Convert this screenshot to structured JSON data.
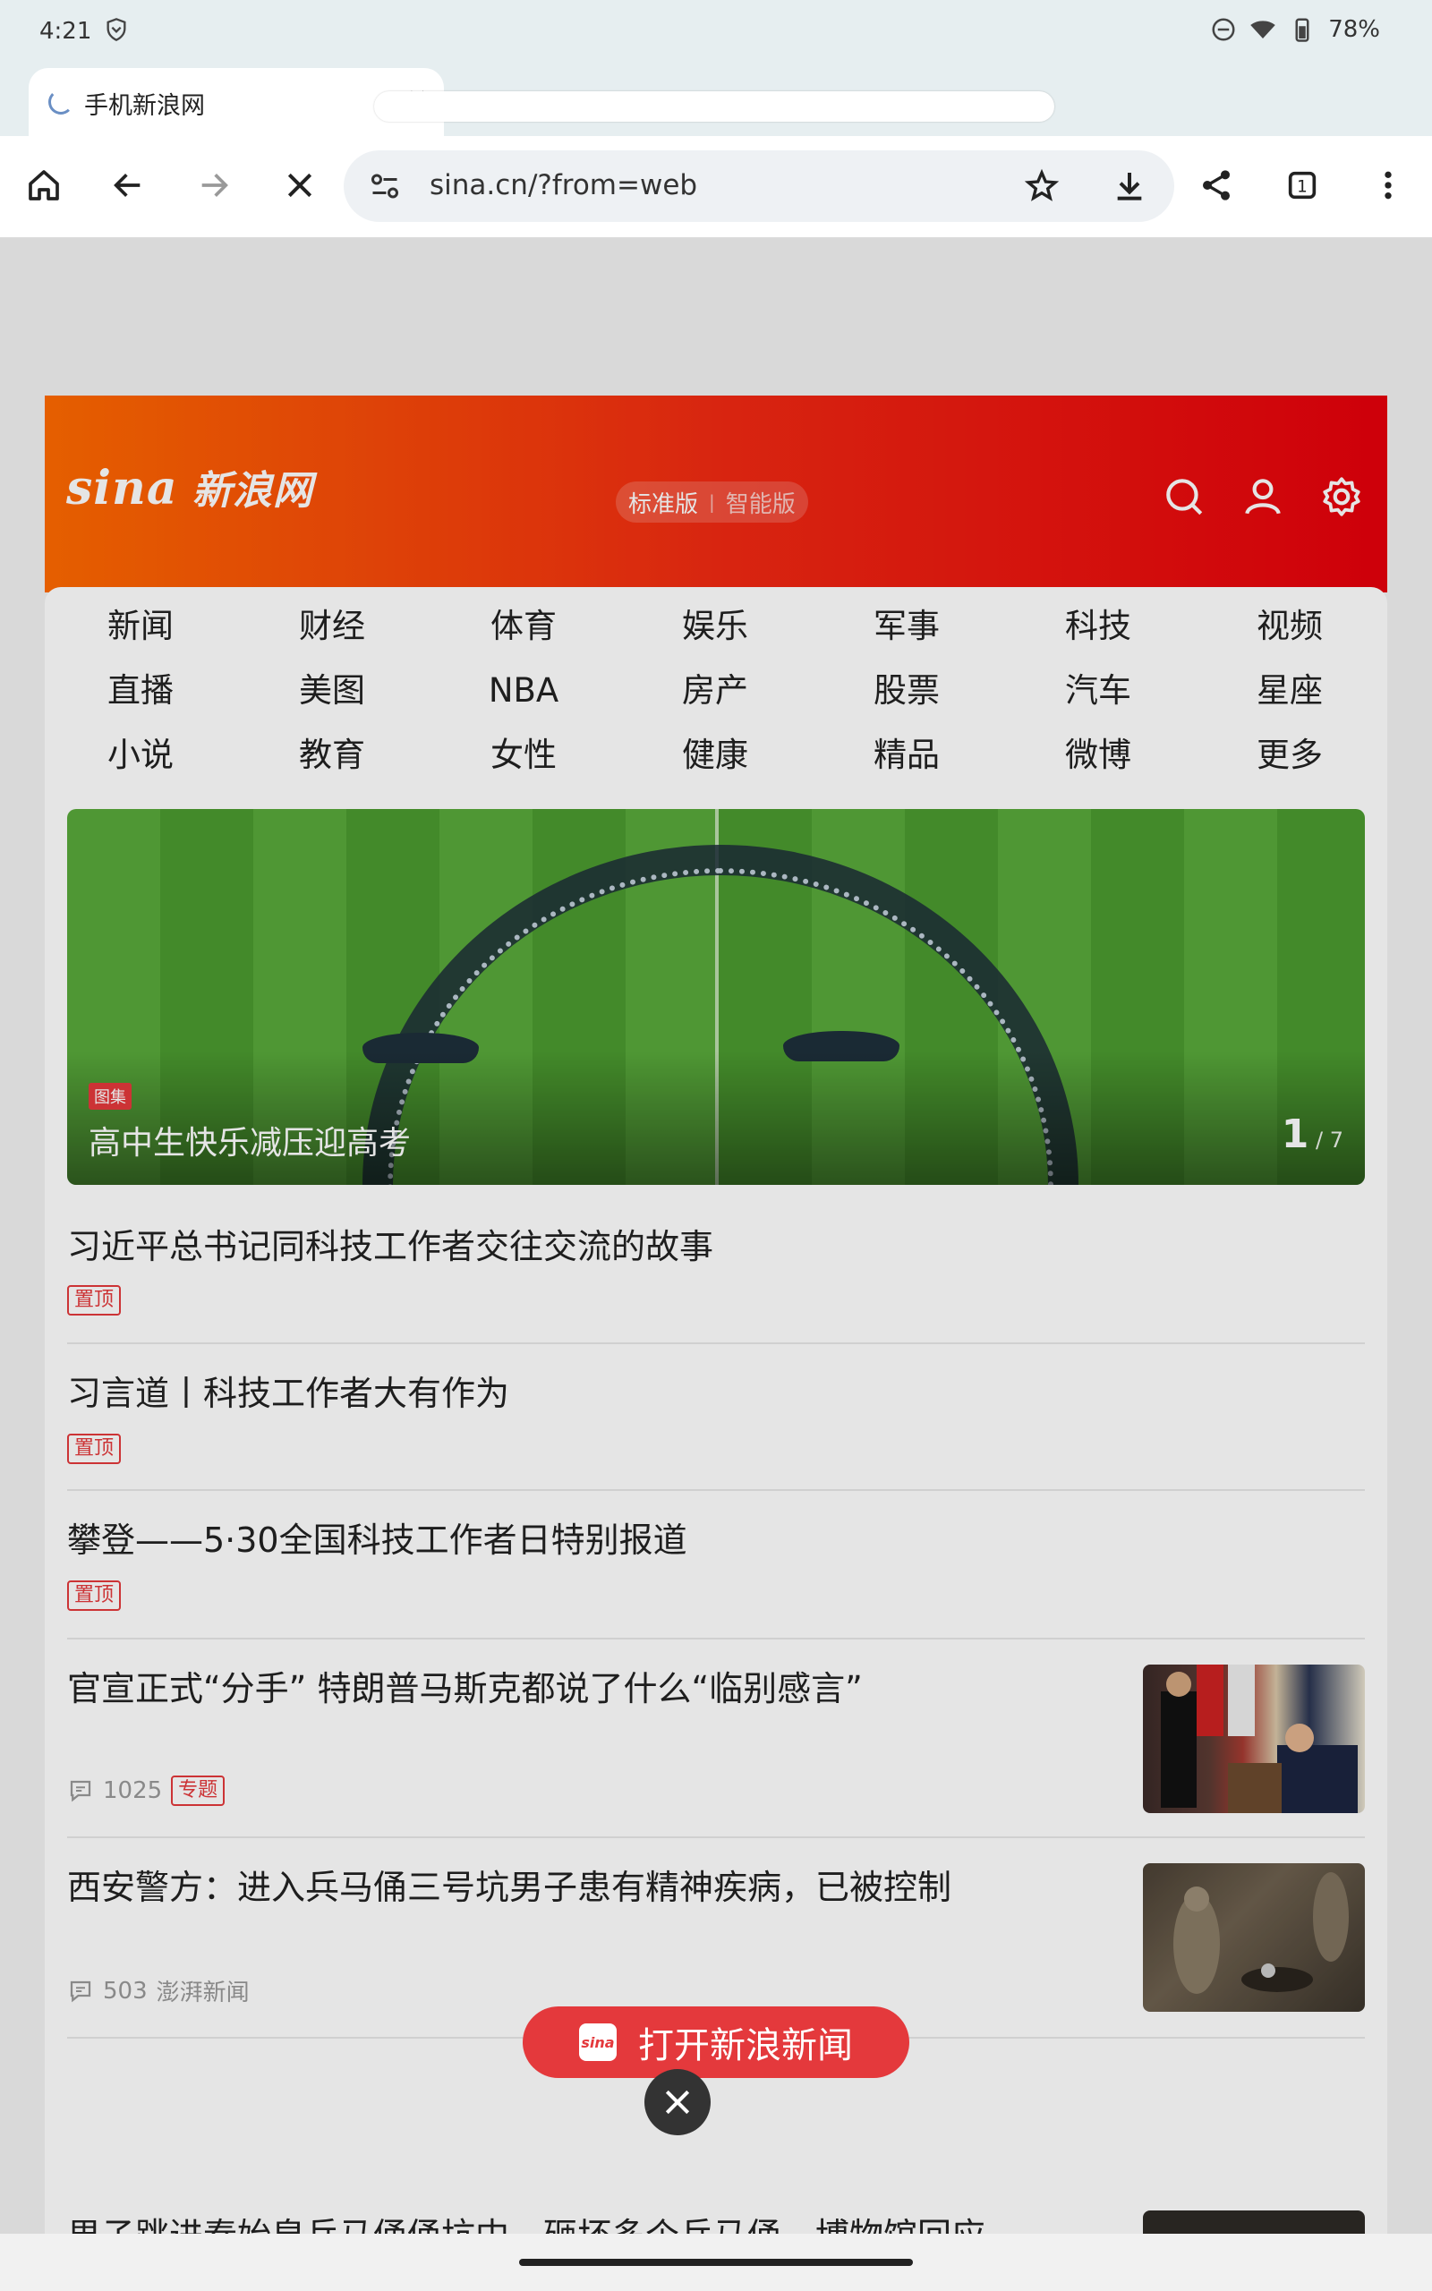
{
  "status_bar": {
    "time": "4:21",
    "battery": "78%"
  },
  "tab": {
    "title": "手机新浪网",
    "close": "×"
  },
  "omnibox": {
    "url": "sina.cn/?from=web"
  },
  "header": {
    "logo_sina": "sina",
    "logo_cn": "新浪网",
    "version_standard": "标准版",
    "version_sep": "|",
    "version_smart": "智能版"
  },
  "nav": [
    "新闻",
    "财经",
    "体育",
    "娱乐",
    "军事",
    "科技",
    "视频",
    "直播",
    "美图",
    "NBA",
    "房产",
    "股票",
    "汽车",
    "星座",
    "小说",
    "教育",
    "女性",
    "健康",
    "精品",
    "微博",
    "更多"
  ],
  "hero": {
    "tag": "图集",
    "caption": "高中生快乐减压迎高考",
    "page_current": "1",
    "page_total": " / 7"
  },
  "news": [
    {
      "title": "习近平总书记同科技工作者交往交流的故事",
      "badge": "置顶"
    },
    {
      "title": "习言道丨科技工作者大有作为",
      "badge": "置顶"
    },
    {
      "title": "攀登——5·30全国科技工作者日特别报道",
      "badge": "置顶"
    },
    {
      "title": "官宣正式“分手” 特朗普马斯克都说了什么“临别感言”",
      "comments": "1025",
      "badge": "专题"
    },
    {
      "title": "西安警方：进入兵马俑三号坑男子患有精神疾病，已被控制",
      "comments": "503",
      "source": "澎湃新闻"
    }
  ],
  "partial_news_title": "男子跳进秦始皇兵马俑俑坑中，砸坏多个兵马俑，博物馆回应",
  "open_app": {
    "label": "打开新浪新闻",
    "logo": "sina"
  },
  "colors": {
    "accent": "#e4393c",
    "header_start": "#ff6a00",
    "header_end": "#e6000c"
  }
}
